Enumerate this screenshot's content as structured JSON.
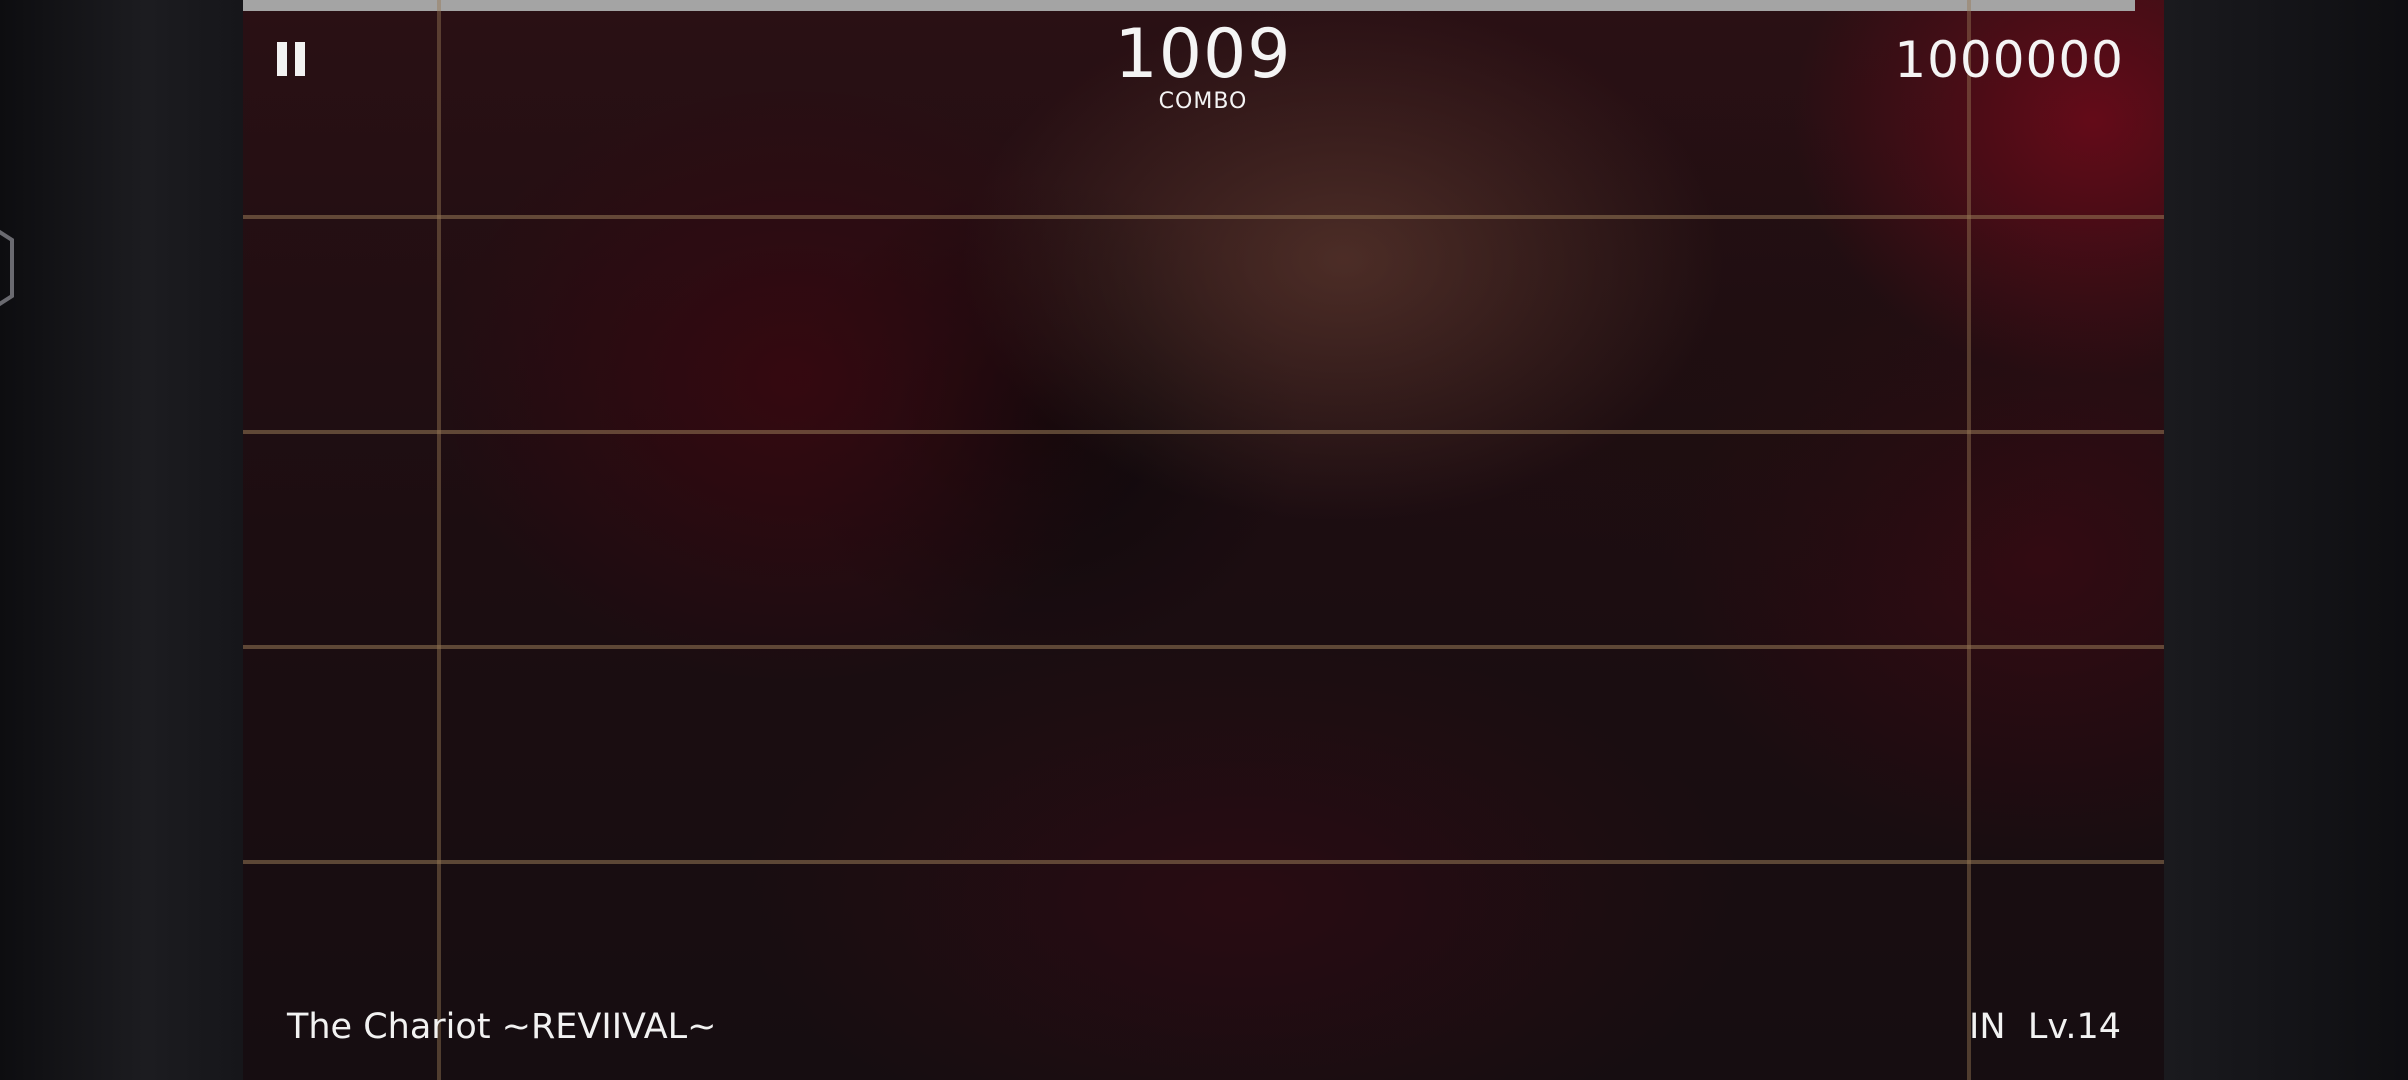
{
  "hud": {
    "combo_count": "1009",
    "combo_label": "COMBO",
    "score": "1000000",
    "pause_icon": "pause-icon"
  },
  "song": {
    "title": "The Chariot ~REVIIVAL~",
    "difficulty": "IN",
    "level": "Lv.14"
  },
  "progress": {
    "fraction": 0.985
  },
  "colors": {
    "accent_text": "#f4f4f4",
    "progress_bar": "#a4a4a4",
    "grid_line": "#96784f"
  }
}
